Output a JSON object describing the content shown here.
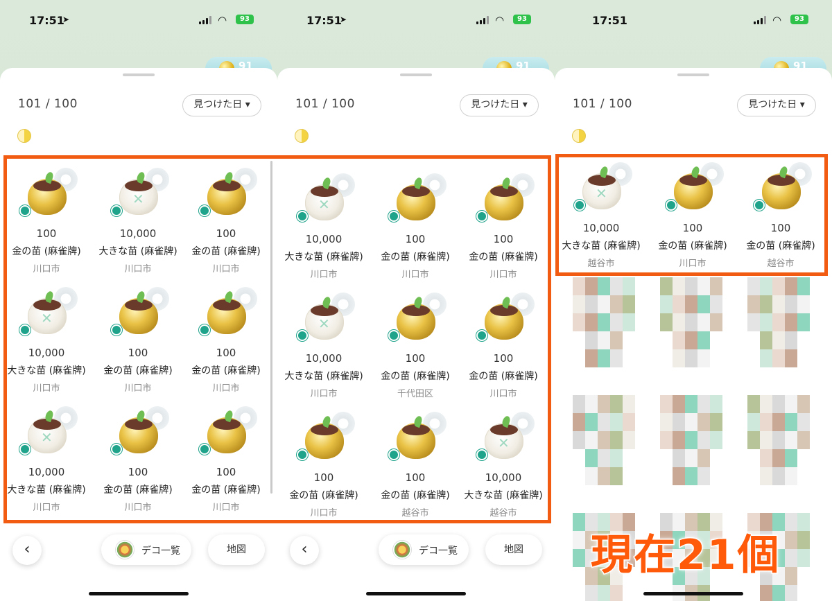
{
  "status": {
    "time": "17:51",
    "battery": "93"
  },
  "coins": "91",
  "header": {
    "count": "101 / 100",
    "sort_label": "見つけた日 ▾"
  },
  "panels": [
    {
      "cells": [
        {
          "value": "100",
          "name": "金の苗 (麻雀牌)",
          "loc": "川口市",
          "kind": "gold"
        },
        {
          "value": "10,000",
          "name": "大きな苗 (麻雀牌)",
          "loc": "川口市",
          "kind": "big"
        },
        {
          "value": "100",
          "name": "金の苗 (麻雀牌)",
          "loc": "川口市",
          "kind": "gold"
        },
        {
          "value": "10,000",
          "name": "大きな苗 (麻雀牌)",
          "loc": "川口市",
          "kind": "big"
        },
        {
          "value": "100",
          "name": "金の苗 (麻雀牌)",
          "loc": "川口市",
          "kind": "gold"
        },
        {
          "value": "100",
          "name": "金の苗 (麻雀牌)",
          "loc": "川口市",
          "kind": "gold"
        },
        {
          "value": "10,000",
          "name": "大きな苗 (麻雀牌)",
          "loc": "川口市",
          "kind": "big"
        },
        {
          "value": "100",
          "name": "金の苗 (麻雀牌)",
          "loc": "川口市",
          "kind": "gold"
        },
        {
          "value": "100",
          "name": "金の苗 (麻雀牌)",
          "loc": "川口市",
          "kind": "gold"
        }
      ]
    },
    {
      "cells": [
        {
          "value": "10,000",
          "name": "大きな苗 (麻雀牌)",
          "loc": "川口市",
          "kind": "big"
        },
        {
          "value": "100",
          "name": "金の苗 (麻雀牌)",
          "loc": "川口市",
          "kind": "gold"
        },
        {
          "value": "100",
          "name": "金の苗 (麻雀牌)",
          "loc": "川口市",
          "kind": "gold"
        },
        {
          "value": "10,000",
          "name": "大きな苗 (麻雀牌)",
          "loc": "川口市",
          "kind": "big"
        },
        {
          "value": "100",
          "name": "金の苗 (麻雀牌)",
          "loc": "千代田区",
          "kind": "gold"
        },
        {
          "value": "100",
          "name": "金の苗 (麻雀牌)",
          "loc": "川口市",
          "kind": "gold"
        },
        {
          "value": "100",
          "name": "金の苗 (麻雀牌)",
          "loc": "川口市",
          "kind": "gold"
        },
        {
          "value": "100",
          "name": "金の苗 (麻雀牌)",
          "loc": "越谷市",
          "kind": "gold"
        },
        {
          "value": "10,000",
          "name": "大きな苗 (麻雀牌)",
          "loc": "越谷市",
          "kind": "big"
        }
      ]
    },
    {
      "cells": [
        {
          "value": "10,000",
          "name": "大きな苗 (麻雀牌)",
          "loc": "越谷市",
          "kind": "big"
        },
        {
          "value": "100",
          "name": "金の苗 (麻雀牌)",
          "loc": "川口市",
          "kind": "gold"
        },
        {
          "value": "100",
          "name": "金の苗 (麻雀牌)",
          "loc": "越谷市",
          "kind": "gold"
        }
      ]
    }
  ],
  "bottom": {
    "deco_label": "デコ一覧",
    "map_label": "地図"
  },
  "caption": "現在21個",
  "icons": {
    "back": "chevron-left-icon",
    "deco": "deco-wreath-icon",
    "location": "location-arrow-icon",
    "wifi": "wifi-icon",
    "coin": "coin-icon",
    "plant_badge": "flower-badge-icon"
  },
  "colors": {
    "highlight": "#f25c12",
    "caption": "#ff5a0a",
    "battery": "#2ec24b",
    "badge": "#1fa38a"
  }
}
